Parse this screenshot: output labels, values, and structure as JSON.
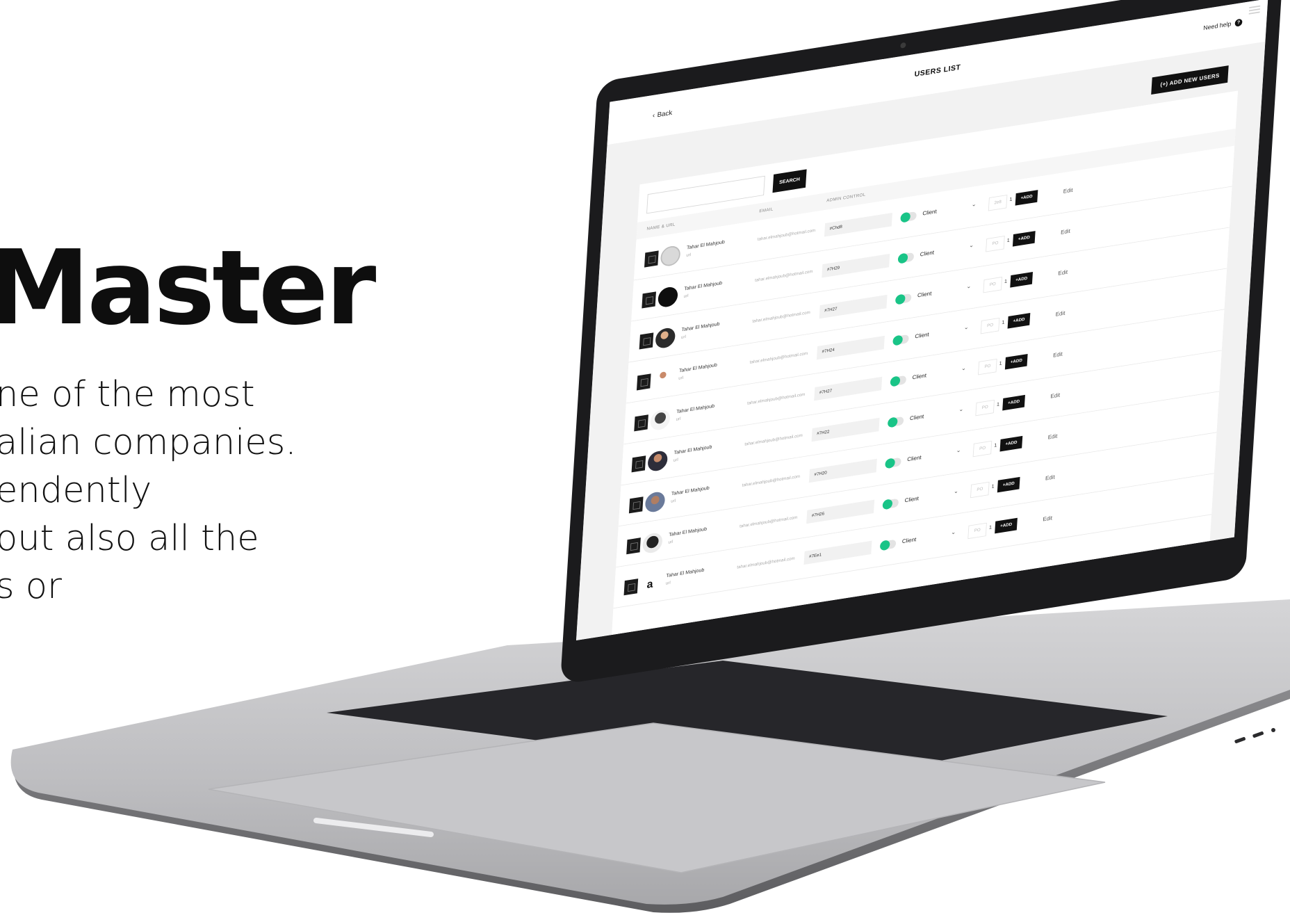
{
  "hero": {
    "title": "Master",
    "lines": [
      "ne of the most",
      "alian companies.",
      "endently",
      "out also all the",
      "s or"
    ]
  },
  "app": {
    "back_label": "Back",
    "title": "USERS LIST",
    "help_label": "Need help",
    "help_icon_glyph": "?",
    "add_user_label": "(+) ADD NEW USERS",
    "search": {
      "value": "",
      "button_label": "SEARCH"
    },
    "columns": [
      "NAME & URL",
      "EMAIL",
      "ADMIN CONTROL"
    ],
    "toggle_color": "#19c487",
    "rows": [
      {
        "name": "Tahar El Mahjoub",
        "role": "url",
        "email": "tahar.elmahjoub@hotmail.com",
        "code": "#Chd8",
        "role_select": "Client",
        "po": "2e8",
        "qty": "1",
        "add": "+ADD",
        "edit": "Edit"
      },
      {
        "name": "Tahar El Mahjoub",
        "role": "url",
        "email": "tahar.elmahjoub@hotmail.com",
        "code": "#7H29",
        "role_select": "Client",
        "po": "PO",
        "qty": "1",
        "add": "+ADD",
        "edit": "Edit"
      },
      {
        "name": "Tahar El Mahjoub",
        "role": "url",
        "email": "tahar.elmahjoub@hotmail.com",
        "code": "#7H27",
        "role_select": "Client",
        "po": "PO",
        "qty": "1",
        "add": "+ADD",
        "edit": "Edit"
      },
      {
        "name": "Tahar El Mahjoub",
        "role": "url",
        "email": "tahar.elmahjoub@hotmail.com",
        "code": "#7H24",
        "role_select": "Client",
        "po": "PO",
        "qty": "1",
        "add": "+ADD",
        "edit": "Edit"
      },
      {
        "name": "Tahar El Mahjoub",
        "role": "url",
        "email": "tahar.elmahjoub@hotmail.com",
        "code": "#7H27",
        "role_select": "Client",
        "po": "PO",
        "qty": "1",
        "add": "+ADD",
        "edit": "Edit"
      },
      {
        "name": "Tahar El Mahjoub",
        "role": "url",
        "email": "tahar.elmahjoub@hotmail.com",
        "code": "#7H22",
        "role_select": "Client",
        "po": "PO",
        "qty": "1",
        "add": "+ADD",
        "edit": "Edit"
      },
      {
        "name": "Tahar El Mahjoub",
        "role": "url",
        "email": "tahar.elmahjoub@hotmail.com",
        "code": "#7H20",
        "role_select": "Client",
        "po": "PO",
        "qty": "1",
        "add": "+ADD",
        "edit": "Edit"
      },
      {
        "name": "Tahar El Mahjoub",
        "role": "url",
        "email": "tahar.elmahjoub@hotmail.com",
        "code": "#7H26",
        "role_select": "Client",
        "po": "PO",
        "qty": "1",
        "add": "+ADD",
        "edit": "Edit"
      },
      {
        "name": "Tahar El Mahjoub",
        "role": "url",
        "email": "tahar.elmahjoub@hotmail.com",
        "code": "#7Ee1",
        "role_select": "Client",
        "po": "PO",
        "qty": "1",
        "add": "+ADD",
        "edit": "Edit"
      }
    ]
  }
}
